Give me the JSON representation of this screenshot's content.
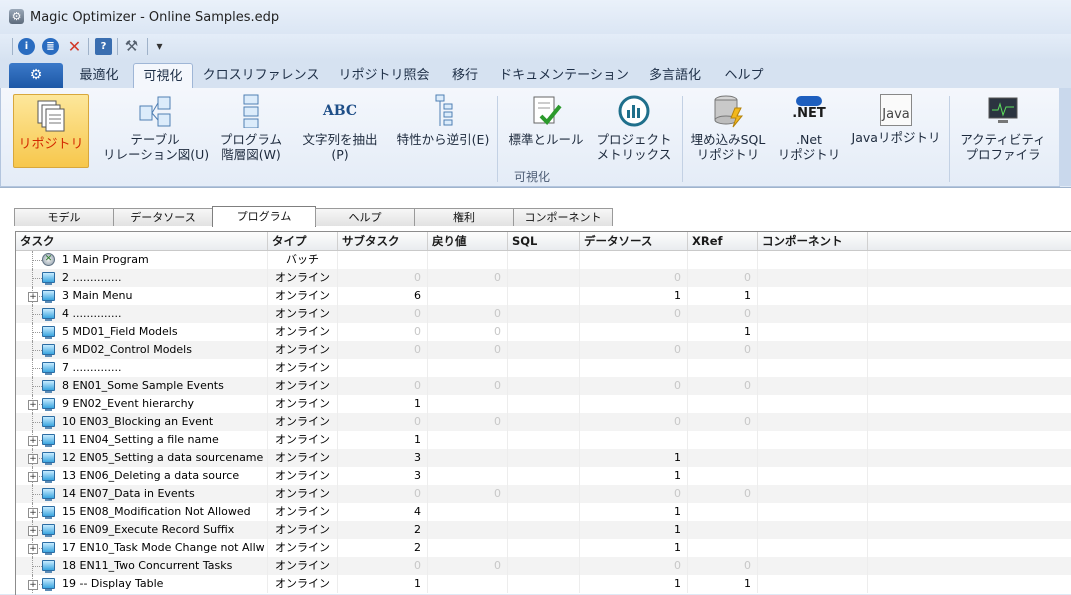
{
  "window": {
    "title": "Magic Optimizer - Online Samples.edp"
  },
  "quick_access": [
    {
      "icon": "info-icon",
      "color": "#2a6cc0",
      "glyph": "i"
    },
    {
      "icon": "analyze-icon",
      "color": "#2a6cc0",
      "glyph": "≣"
    },
    {
      "icon": "close-icon",
      "color": "#d23a2a",
      "glyph": "✕"
    },
    {
      "icon": "help-book-icon",
      "color": "#3a6eb0",
      "glyph": "?"
    },
    {
      "icon": "tools-icon",
      "color": "#55606e",
      "glyph": "⚒"
    },
    {
      "icon": "customize-dropdown-icon",
      "color": "#333",
      "glyph": "▾"
    }
  ],
  "ribbon_tabs": [
    "最適化",
    "可視化",
    "クロスリファレンス",
    "リポジトリ照会",
    "移行",
    "ドキュメンテーション",
    "多言語化",
    "ヘルプ"
  ],
  "ribbon_buttons": [
    {
      "label": "リポジトリ",
      "icon": "repository-icon"
    },
    {
      "label": "テーブル\nリレーション図(U)",
      "icon": "table-relation-icon"
    },
    {
      "label": "プログラム\n階層図(W)",
      "icon": "program-hierarchy-icon"
    },
    {
      "label": "文字列を抽出(P)",
      "icon": "abc-text-icon",
      "glyph": "ABC"
    },
    {
      "label": "特性から逆引(E)",
      "icon": "reverse-lookup-icon"
    },
    {
      "label": "標準とルール",
      "icon": "standards-rules-icon"
    },
    {
      "label": "プロジェクト\nメトリックス",
      "icon": "metrics-icon"
    },
    {
      "label": "埋め込みSQL\nリポジトリ",
      "icon": "sql-repository-icon"
    },
    {
      "label": ".Net\nリポジトリ",
      "icon": "dotnet-icon",
      "glyph": ".NET"
    },
    {
      "label": "Javaリポジトリ",
      "icon": "java-icon",
      "glyph": "Java"
    },
    {
      "label": "アクティビティ\nプロファイラ",
      "icon": "activity-profiler-icon"
    }
  ],
  "ribbon_group_label": "可視化",
  "doc_tabs": [
    "モデル",
    "データソース",
    "プログラム",
    "ヘルプ",
    "権利",
    "コンポーネント"
  ],
  "grid": {
    "columns": [
      "タスク",
      "タイプ",
      "サブタスク",
      "戻り値",
      "SQL",
      "データソース",
      "XRef",
      "コンポーネント"
    ],
    "rows": [
      {
        "name": "1 Main Program",
        "type": "バッチ",
        "sub": "",
        "ret": "",
        "sql": "",
        "ds": "",
        "xref": "",
        "icon": "batch",
        "exp": false
      },
      {
        "name": "2 ..............",
        "type": "オンライン",
        "sub": "0",
        "ret": "0",
        "sql": "",
        "ds": "0",
        "xref": "0",
        "icon": "task",
        "exp": false
      },
      {
        "name": "3 Main Menu",
        "type": "オンライン",
        "sub": "6",
        "ret": "",
        "sql": "",
        "ds": "1",
        "xref": "1",
        "icon": "task",
        "exp": true
      },
      {
        "name": "4 ..............",
        "type": "オンライン",
        "sub": "0",
        "ret": "0",
        "sql": "",
        "ds": "0",
        "xref": "0",
        "icon": "task",
        "exp": false
      },
      {
        "name": "5 MD01_Field Models",
        "type": "オンライン",
        "sub": "0",
        "ret": "0",
        "sql": "",
        "ds": "",
        "xref": "1",
        "icon": "task",
        "exp": false
      },
      {
        "name": "6 MD02_Control Models",
        "type": "オンライン",
        "sub": "0",
        "ret": "0",
        "sql": "",
        "ds": "0",
        "xref": "0",
        "icon": "task",
        "exp": false
      },
      {
        "name": "7 ..............",
        "type": "オンライン",
        "sub": "",
        "ret": "",
        "sql": "",
        "ds": "",
        "xref": "",
        "icon": "task",
        "exp": false
      },
      {
        "name": "8 EN01_Some Sample Events",
        "type": "オンライン",
        "sub": "0",
        "ret": "0",
        "sql": "",
        "ds": "0",
        "xref": "0",
        "icon": "task",
        "exp": false
      },
      {
        "name": "9 EN02_Event hierarchy",
        "type": "オンライン",
        "sub": "1",
        "ret": "",
        "sql": "",
        "ds": "",
        "xref": "",
        "icon": "task",
        "exp": true
      },
      {
        "name": "10 EN03_Blocking an Event",
        "type": "オンライン",
        "sub": "0",
        "ret": "0",
        "sql": "",
        "ds": "0",
        "xref": "0",
        "icon": "task",
        "exp": false
      },
      {
        "name": "11 EN04_Setting a file name",
        "type": "オンライン",
        "sub": "1",
        "ret": "",
        "sql": "",
        "ds": "",
        "xref": "",
        "icon": "task",
        "exp": true
      },
      {
        "name": "12 EN05_Setting a data sourcename",
        "type": "オンライン",
        "sub": "3",
        "ret": "",
        "sql": "",
        "ds": "1",
        "xref": "",
        "icon": "task",
        "exp": true
      },
      {
        "name": "13 EN06_Deleting a data source",
        "type": "オンライン",
        "sub": "3",
        "ret": "",
        "sql": "",
        "ds": "1",
        "xref": "",
        "icon": "task",
        "exp": true
      },
      {
        "name": "14 EN07_Data in Events",
        "type": "オンライン",
        "sub": "0",
        "ret": "0",
        "sql": "",
        "ds": "0",
        "xref": "0",
        "icon": "task",
        "exp": false
      },
      {
        "name": "15 EN08_Modification Not Allowed",
        "type": "オンライン",
        "sub": "4",
        "ret": "",
        "sql": "",
        "ds": "1",
        "xref": "",
        "icon": "task",
        "exp": true
      },
      {
        "name": "16 EN09_Execute Record Suffix",
        "type": "オンライン",
        "sub": "2",
        "ret": "",
        "sql": "",
        "ds": "1",
        "xref": "",
        "icon": "task",
        "exp": true
      },
      {
        "name": "17 EN10_Task Mode Change not Allw",
        "type": "オンライン",
        "sub": "2",
        "ret": "",
        "sql": "",
        "ds": "1",
        "xref": "",
        "icon": "task",
        "exp": true
      },
      {
        "name": "18 EN11_Two Concurrent Tasks",
        "type": "オンライン",
        "sub": "0",
        "ret": "0",
        "sql": "",
        "ds": "0",
        "xref": "0",
        "icon": "task",
        "exp": false
      },
      {
        "name": "19 -- Display Table",
        "type": "オンライン",
        "sub": "1",
        "ret": "",
        "sql": "",
        "ds": "1",
        "xref": "1",
        "icon": "task",
        "exp": true
      }
    ]
  }
}
